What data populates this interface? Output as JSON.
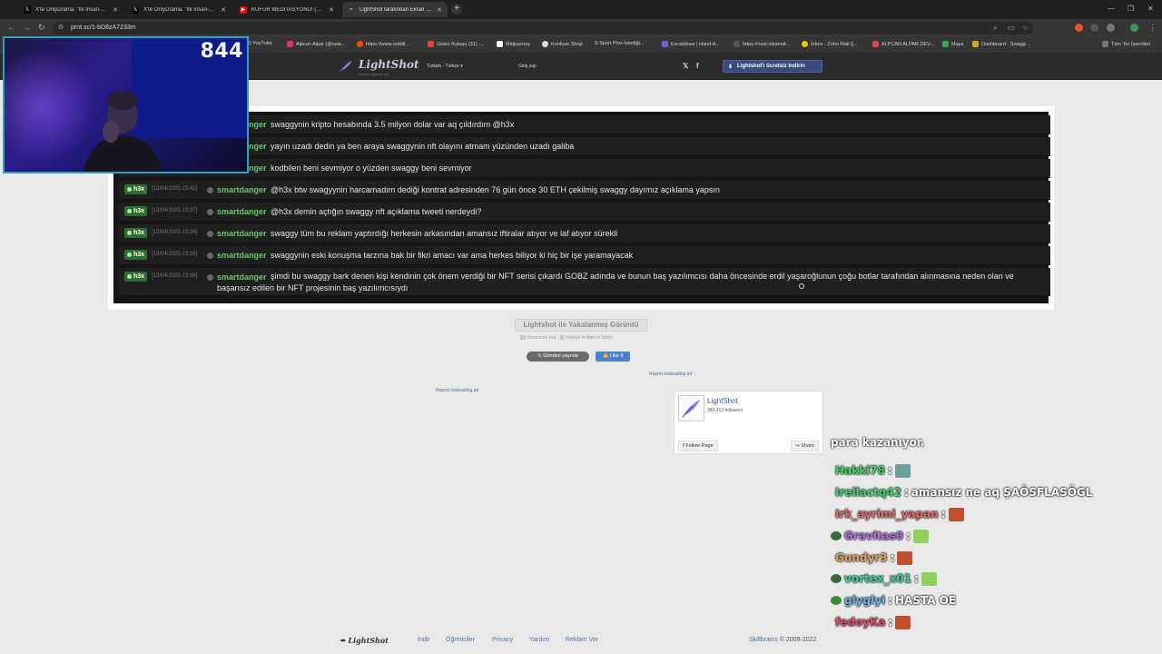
{
  "browser": {
    "tabs": [
      {
        "title": "X'te OnlyDrama: \"İlk İnsan-Jahv",
        "fav_color": "#000000",
        "active": false
      },
      {
        "title": "X'te OnlyDrama: \"İlk İnsan-Jahv",
        "fav_color": "#000000",
        "active": false
      },
      {
        "title": "KÜFÜR MEDİTASYONU! (Şifa K",
        "fav_color": "#ff0000",
        "active": false
      },
      {
        "title": "LightShot tarafından Ekran Görü",
        "fav_color": "#6b5bd1",
        "active": true
      }
    ],
    "url": "prnt.sc/1-bD8zA7233m",
    "bookmarks": [
      {
        "label": "(2) YouTube",
        "color": "#ff0000"
      },
      {
        "label": "Alpcan Alpar (@swa...",
        "color": "#e1306c"
      },
      {
        "label": "https://www.reddit...",
        "color": "#ff4500"
      },
      {
        "label": "Gelen Kutusu (31) -...",
        "color": "#ea4335"
      },
      {
        "label": "Midjourney",
        "color": "#ffffff"
      },
      {
        "label": "Konfuse Shop",
        "color": "#dddddd"
      },
      {
        "label": "S Sport Plus-İstediği...",
        "color": "#333333"
      },
      {
        "label": "Excalidraw | Hand-d...",
        "color": "#6965db"
      },
      {
        "label": "https://nest.inkamat...",
        "color": "#333333"
      },
      {
        "label": "Inbox - Zoho Mail (j...",
        "color": "#f5c400"
      },
      {
        "label": "ALPCAN ALPAR DEV...",
        "color": "#d44"
      },
      {
        "label": "Maps",
        "color": "#34a853"
      },
      {
        "label": "Dashboard - Swagg...",
        "color": "#e0a020"
      }
    ],
    "all_bookmarks": "Tüm Yer İşaretleri"
  },
  "webcam": {
    "viewer_count": "844"
  },
  "lightshot": {
    "logo": "LightShot",
    "tagline": "screen capture tool",
    "language": "Turkish - Türkçe",
    "login": "Giriş yap",
    "twitter": "𝕏",
    "facebook": "f",
    "download": "Lightshot'ı ücretsiz indirin"
  },
  "chat": {
    "rows": [
      {
        "badge": "",
        "time": "",
        "user": "smartdanger",
        "msg": "swaggynin kripto hesabında 3.5 milyon dolar var aq çıldırdım @h3x"
      },
      {
        "badge": "",
        "time": "",
        "user": "smartdanger",
        "msg": "yayın uzadı dedin ya ben araya swaggynin nft olayını atmam yüzünden uzadı galiba"
      },
      {
        "badge": "",
        "time": "",
        "user": "smartdanger",
        "msg": "kodbilen beni sevmiyor o yüzden swaggy beni sevmiyor"
      },
      {
        "badge": "h3x",
        "time": "[13/04/2025 23:42]",
        "user": "smartdanger",
        "msg": "@h3x btw swagyynin harcamadım dediği kontrat adresinden 76 gün önce 30 ETH çekilmiş swaggy dayımız açıklama yapsın"
      },
      {
        "badge": "h3x",
        "time": "[13/04/2025 23:37]",
        "user": "smartdanger",
        "msg": "@h3x demin açtığın swaggy nft açıklama tweeti nerdeydi?"
      },
      {
        "badge": "h3x",
        "time": "[13/04/2025 23:24]",
        "user": "smartdanger",
        "msg": "swaggy tüm bu reklam yaptırdığı herkesin arkasından amansız iftiralar atıyor ve laf atıyor sürekli"
      },
      {
        "badge": "h3x",
        "time": "[13/04/2025 23:18]",
        "user": "smartdanger",
        "msg": "swaggynin eski konuşma tarzına bak bir fikri amacı var ama herkes biliyor ki hiç bir işe yaramayacak"
      },
      {
        "badge": "h3x",
        "time": "[13/04/2025 23:09]",
        "user": "smartdanger",
        "msg": "şimdi bu swaggy bark denen kişi kendinin çok önem verdiği bir NFT serisi çıkardı GOBZ adında ve bunun baş yazılımcısı daha öncesinde erdil yaşaroğlunun çoğu botlar tarafından alınmasına neden olan ve başarısız edilen bir NFT projesinin baş yazılımcısıydı"
      }
    ]
  },
  "capture": {
    "title": "Lightshot ile Yakalanmış Görüntü",
    "similar": "benzerini bul",
    "report_abuse": "kötüye kullanım bildir",
    "tweet": "𝕏 Gönderi yayınla",
    "like": "👍 Like 0",
    "report_ad": "Report misleading ad"
  },
  "fb_widget": {
    "name": "LightShot",
    "followers": "383,413 followers",
    "follow": "Follow Page",
    "share": "↪ Share"
  },
  "stream_chat": [
    {
      "user": "para kazanıyor.",
      "color": "#ffffff",
      "text": "",
      "emote": "",
      "partial": true
    },
    {
      "user": "Hakki78",
      "color": "#3fd16a",
      "text": "",
      "emote": "#6aa0a0"
    },
    {
      "user": "Irellactq42",
      "color": "#3fd16a",
      "text": "amansız ne aq ŞAÖSFLASÖGL",
      "emote": ""
    },
    {
      "user": "Irk_ayrimi_yapan",
      "color": "#e06a6a",
      "text": "",
      "emote": "#c05030"
    },
    {
      "user": "Gravitas0",
      "color": "#b36ae0",
      "text": "",
      "emote": "#8fd05a",
      "badge": "#3a6a3a"
    },
    {
      "user": "Gundyr3",
      "color": "#e0a56a",
      "text": "",
      "emote": "#c05030"
    },
    {
      "user": "vortex_x01",
      "color": "#3fd1a0",
      "text": "",
      "emote": "#8fd05a",
      "badge": "#3a6a3a"
    },
    {
      "user": "glyglyi",
      "color": "#6ab0e0",
      "text": "HASTA OE",
      "emote": "",
      "badge": "#3a8a3a"
    },
    {
      "user": "fedoyKa",
      "color": "#e04a6a",
      "text": "",
      "emote": "#c05030"
    }
  ],
  "footer": {
    "logo": "LightShot",
    "links": [
      "İndir",
      "Öğreticiler",
      "Privacy",
      "Yardım",
      "Reklam Ver"
    ],
    "company": "Skillbrains",
    "copyright": "© 2009-2022"
  }
}
